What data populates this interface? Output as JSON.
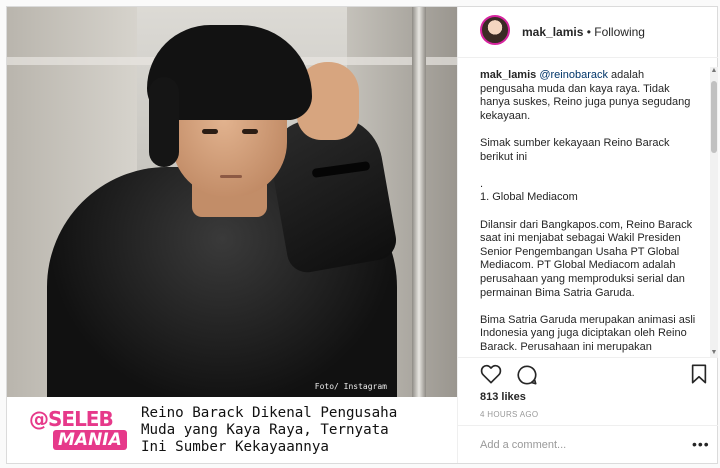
{
  "post": {
    "credit": "Foto/ Instagram"
  },
  "banner": {
    "logo_at": "@SELEB",
    "logo_mania": "MANIA",
    "headline_1": "Reino Barack Dikenal Pengusaha",
    "headline_2": "Muda yang Kaya Raya, Ternyata",
    "headline_3": "Ini Sumber Kekayaannya"
  },
  "header": {
    "username": "mak_lamis",
    "separator": " • ",
    "follow_status": "Following"
  },
  "caption": {
    "username": "mak_lamis",
    "mention": "@reinobarack",
    "p1": "adalah pengusaha muda dan kaya raya. Tidak hanya suskes, Reino juga punya segudang kekayaan.",
    "p2": "Simak sumber kekayaan Reino Barack berikut ini",
    "p3": ".",
    "p4": "1. Global Mediacom",
    "p5": "Dilansir dari Bangkapos.com, Reino Barack saat ini menjabat sebagai Wakil Presiden Senior Pengembangan Usaha PT Global Mediacom. PT Global Mediacom adalah perusahaan yang memproduksi serial dan permainan Bima Satria Garuda.",
    "p6": "Bima Satria Garuda merupakan animasi asli Indonesia yang juga diciptakan oleh Reino Barack. Perusahaan ini merupakan perusahaan investasi milik Media"
  },
  "engagement": {
    "likes": "813 likes",
    "time": "4 HOURS AGO"
  },
  "comment": {
    "placeholder": "Add a comment...",
    "more": "•••"
  },
  "icons": {
    "like": "heart-icon",
    "comment": "comment-icon",
    "save": "bookmark-icon",
    "more": "ellipsis-icon"
  },
  "colors": {
    "brand_pink": "#e6398a",
    "link": "#003569",
    "muted": "#999999"
  }
}
